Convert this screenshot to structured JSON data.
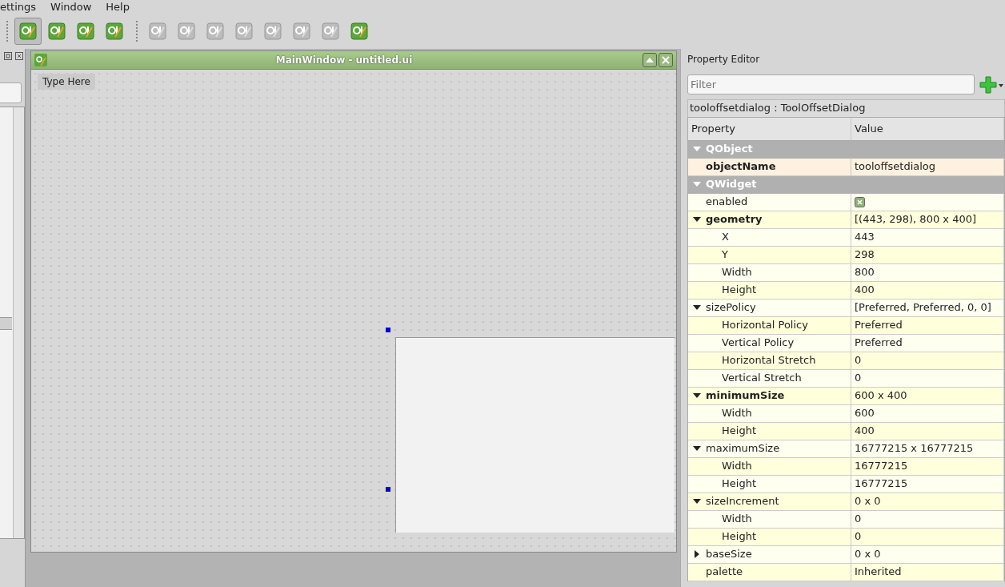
{
  "menu_bar": {
    "items": [
      "ettings",
      "Window",
      "Help"
    ]
  },
  "toolbar": {
    "groups": [
      [
        {
          "disabled": false,
          "selected": true
        },
        {
          "disabled": false,
          "selected": false
        },
        {
          "disabled": false,
          "selected": false
        },
        {
          "disabled": false,
          "selected": false
        }
      ],
      [
        {
          "disabled": true,
          "selected": false
        },
        {
          "disabled": true,
          "selected": false
        },
        {
          "disabled": true,
          "selected": false
        },
        {
          "disabled": true,
          "selected": false
        },
        {
          "disabled": true,
          "selected": false
        },
        {
          "disabled": true,
          "selected": false
        },
        {
          "disabled": true,
          "selected": false
        },
        {
          "disabled": false,
          "selected": false
        }
      ]
    ]
  },
  "form_window": {
    "title": "MainWindow - untitled.ui",
    "menu_placeholder": "Type Here"
  },
  "property_editor": {
    "title": "Property Editor",
    "filter": {
      "placeholder": "Filter"
    },
    "object_label": "tooloffsetdialog : ToolOffsetDialog",
    "columns": [
      "Property",
      "Value"
    ],
    "rows": [
      {
        "kind": "group",
        "name": "QObject",
        "expanded": true
      },
      {
        "kind": "property",
        "name": "objectName",
        "value": "tooloffsetdialog",
        "modified": true,
        "highlight": true
      },
      {
        "kind": "group",
        "name": "QWidget",
        "expanded": true
      },
      {
        "kind": "checkbox",
        "name": "enabled",
        "checked": true,
        "modified": false
      },
      {
        "kind": "property",
        "name": "geometry",
        "value": "[(443, 298), 800 x 400]",
        "modified": true,
        "expanded": true,
        "children": [
          {
            "kind": "property",
            "name": "X",
            "value": "443"
          },
          {
            "kind": "property",
            "name": "Y",
            "value": "298"
          },
          {
            "kind": "property",
            "name": "Width",
            "value": "800"
          },
          {
            "kind": "property",
            "name": "Height",
            "value": "400"
          }
        ]
      },
      {
        "kind": "property",
        "name": "sizePolicy",
        "value": "[Preferred, Preferred, 0, 0]",
        "modified": false,
        "expanded": true,
        "children": [
          {
            "kind": "property",
            "name": "Horizontal Policy",
            "value": "Preferred"
          },
          {
            "kind": "property",
            "name": "Vertical Policy",
            "value": "Preferred"
          },
          {
            "kind": "property",
            "name": "Horizontal Stretch",
            "value": "0"
          },
          {
            "kind": "property",
            "name": "Vertical Stretch",
            "value": "0"
          }
        ]
      },
      {
        "kind": "property",
        "name": "minimumSize",
        "value": "600 x 400",
        "modified": true,
        "expanded": true,
        "children": [
          {
            "kind": "property",
            "name": "Width",
            "value": "600"
          },
          {
            "kind": "property",
            "name": "Height",
            "value": "400"
          }
        ]
      },
      {
        "kind": "property",
        "name": "maximumSize",
        "value": "16777215 x 16777215",
        "modified": false,
        "expanded": true,
        "children": [
          {
            "kind": "property",
            "name": "Width",
            "value": "16777215"
          },
          {
            "kind": "property",
            "name": "Height",
            "value": "16777215"
          }
        ]
      },
      {
        "kind": "property",
        "name": "sizeIncrement",
        "value": "0 x 0",
        "modified": false,
        "expanded": true,
        "children": [
          {
            "kind": "property",
            "name": "Width",
            "value": "0"
          },
          {
            "kind": "property",
            "name": "Height",
            "value": "0"
          }
        ]
      },
      {
        "kind": "property",
        "name": "baseSize",
        "value": "0 x 0",
        "modified": false,
        "expanded": false
      },
      {
        "kind": "property",
        "name": "palette",
        "value": "Inherited",
        "modified": false
      }
    ]
  }
}
